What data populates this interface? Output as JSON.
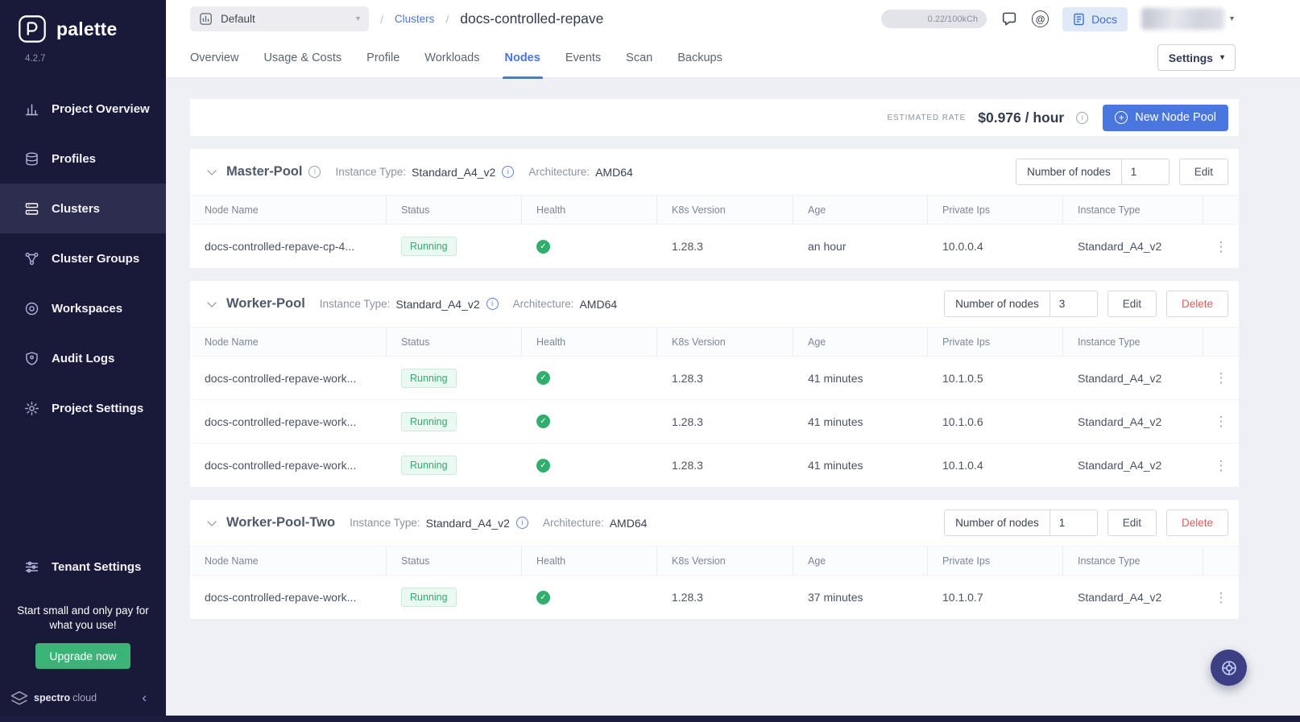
{
  "icons": {
    "chevron_down": "▾",
    "kebab": "⋮",
    "plus": "+",
    "at": "@",
    "collapse": "‹",
    "check": "✓",
    "info": "i"
  },
  "colors": {
    "accent_blue": "#4a77dd",
    "success_green": "#2fae6e",
    "danger_red": "#df5a5e",
    "sidebar_navy": "#191939"
  },
  "sidebar": {
    "brand": "palette",
    "version": "4.2.7",
    "items": [
      {
        "label": "Project Overview"
      },
      {
        "label": "Profiles"
      },
      {
        "label": "Clusters"
      },
      {
        "label": "Cluster Groups"
      },
      {
        "label": "Workspaces"
      },
      {
        "label": "Audit Logs"
      },
      {
        "label": "Project Settings"
      }
    ],
    "tenant_settings_label": "Tenant Settings",
    "promo": "Start small and only pay for what you use!",
    "upgrade_button": "Upgrade now",
    "footer_brand_bold": "spectro",
    "footer_brand_light": "cloud"
  },
  "header": {
    "project_selector": "Default",
    "breadcrumb_separator": "/",
    "breadcrumb_link": "Clusters",
    "page_title": "docs-controlled-repave",
    "usage_counter": "0.22/100kCh",
    "docs_button": "Docs"
  },
  "tabs": {
    "labels": [
      "Overview",
      "Usage & Costs",
      "Profile",
      "Workloads",
      "Nodes",
      "Events",
      "Scan",
      "Backups"
    ],
    "active": "Nodes",
    "settings_button": "Settings"
  },
  "rate_bar": {
    "label": "ESTIMATED RATE",
    "value": "$0.976 / hour",
    "new_pool_button": "New Node Pool"
  },
  "table": {
    "headers": [
      "Node Name",
      "Status",
      "Health",
      "K8s Version",
      "Age",
      "Private Ips",
      "Instance Type"
    ]
  },
  "pools": [
    {
      "name": "Master-Pool",
      "instance_type_label": "Instance Type:",
      "instance_type": "Standard_A4_v2",
      "architecture_label": "Architecture:",
      "architecture": "AMD64",
      "nodes_label": "Number of nodes",
      "nodes_count": "1",
      "edit_button": "Edit",
      "rows": [
        {
          "name": "docs-controlled-repave-cp-4...",
          "status": "Running",
          "k8s_version": "1.28.3",
          "age": "an hour",
          "private_ip": "10.0.0.4",
          "instance_type": "Standard_A4_v2"
        }
      ]
    },
    {
      "name": "Worker-Pool",
      "instance_type_label": "Instance Type:",
      "instance_type": "Standard_A4_v2",
      "architecture_label": "Architecture:",
      "architecture": "AMD64",
      "nodes_label": "Number of nodes",
      "nodes_count": "3",
      "edit_button": "Edit",
      "delete_button": "Delete",
      "rows": [
        {
          "name": "docs-controlled-repave-work...",
          "status": "Running",
          "k8s_version": "1.28.3",
          "age": "41 minutes",
          "private_ip": "10.1.0.5",
          "instance_type": "Standard_A4_v2"
        },
        {
          "name": "docs-controlled-repave-work...",
          "status": "Running",
          "k8s_version": "1.28.3",
          "age": "41 minutes",
          "private_ip": "10.1.0.6",
          "instance_type": "Standard_A4_v2"
        },
        {
          "name": "docs-controlled-repave-work...",
          "status": "Running",
          "k8s_version": "1.28.3",
          "age": "41 minutes",
          "private_ip": "10.1.0.4",
          "instance_type": "Standard_A4_v2"
        }
      ]
    },
    {
      "name": "Worker-Pool-Two",
      "instance_type_label": "Instance Type:",
      "instance_type": "Standard_A4_v2",
      "architecture_label": "Architecture:",
      "architecture": "AMD64",
      "nodes_label": "Number of nodes",
      "nodes_count": "1",
      "edit_button": "Edit",
      "delete_button": "Delete",
      "rows": [
        {
          "name": "docs-controlled-repave-work...",
          "status": "Running",
          "k8s_version": "1.28.3",
          "age": "37 minutes",
          "private_ip": "10.1.0.7",
          "instance_type": "Standard_A4_v2"
        }
      ]
    }
  ]
}
